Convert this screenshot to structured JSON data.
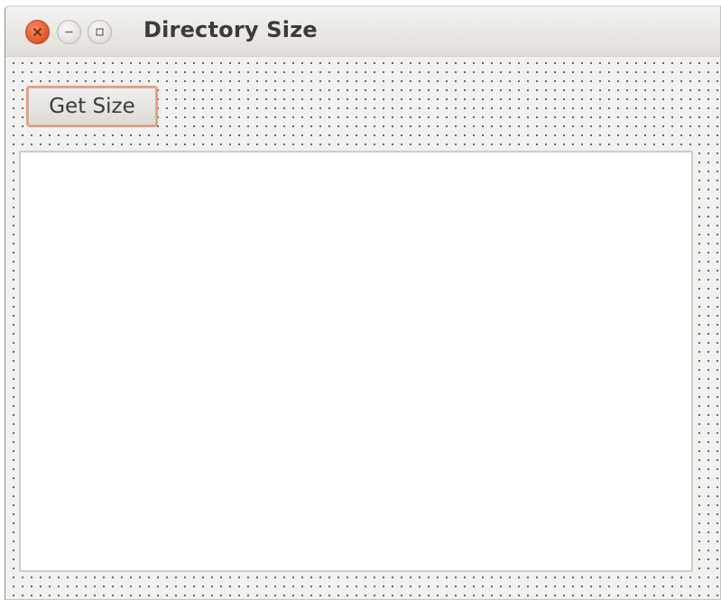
{
  "window": {
    "title": "Directory Size"
  },
  "controls": {
    "get_size_label": "Get Size"
  },
  "output": {
    "text": ""
  },
  "icons": {
    "close": "close-icon",
    "minimize": "minimize-icon",
    "maximize": "maximize-icon"
  },
  "colors": {
    "close_button": "#e65a2c",
    "focus_ring": "#f09a72",
    "title_text": "#3c3b37"
  }
}
